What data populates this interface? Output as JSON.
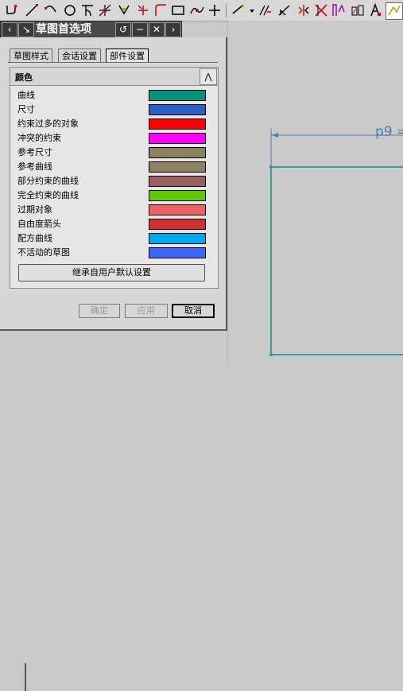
{
  "colors": {
    "sketch_line": "#009a7a",
    "dim_line": "#4a7fb0",
    "titlebar_bg": "#4a4a4a"
  },
  "toolbar": {
    "icons": [
      "profile-icon",
      "line-icon",
      "arc-icon",
      "circle-icon",
      "fillet-icon",
      "chamfer-icon",
      "rectangle-icon",
      "polygon-icon",
      "point-icon",
      "studio-spline-icon",
      "quick-trim-icon",
      "quick-extend-icon",
      "make-corner-icon",
      "offset-curve-icon",
      "mirror-curve-icon",
      "pattern-curve-icon",
      "derived-lines-icon",
      "project-curve-icon",
      "intersection-icon",
      "associative-icon",
      "constraints-icon"
    ]
  },
  "dialog": {
    "title": "草图首选项",
    "tabs": [
      "草图样式",
      "会话设置",
      "部件设置"
    ],
    "active_tab": "部件设置",
    "group_title": "颜色",
    "color_rows": [
      {
        "label": "曲线",
        "color": "#00957a"
      },
      {
        "label": "尺寸",
        "color": "#2d5fcc"
      },
      {
        "label": "约束过多的对象",
        "color": "#ff0000"
      },
      {
        "label": "冲突的约束",
        "color": "#ff00ff"
      },
      {
        "label": "参考尺寸",
        "color": "#8c8262"
      },
      {
        "label": "参考曲线",
        "color": "#8c8262"
      },
      {
        "label": "部分约束的曲线",
        "color": "#9a6060"
      },
      {
        "label": "完全约束的曲线",
        "color": "#5ec800"
      },
      {
        "label": "过期对象",
        "color": "#f06060"
      },
      {
        "label": "自由度箭头",
        "color": "#d03030"
      },
      {
        "label": "配方曲线",
        "color": "#00a8f0"
      },
      {
        "label": "不活动的草图",
        "color": "#3c64ff"
      }
    ],
    "inherit_label": "继承自用户默认设置",
    "ok_label": "确定",
    "apply_label": "应用",
    "cancel_label": "取消"
  },
  "canvas": {
    "dimension_label": "p9 ="
  }
}
